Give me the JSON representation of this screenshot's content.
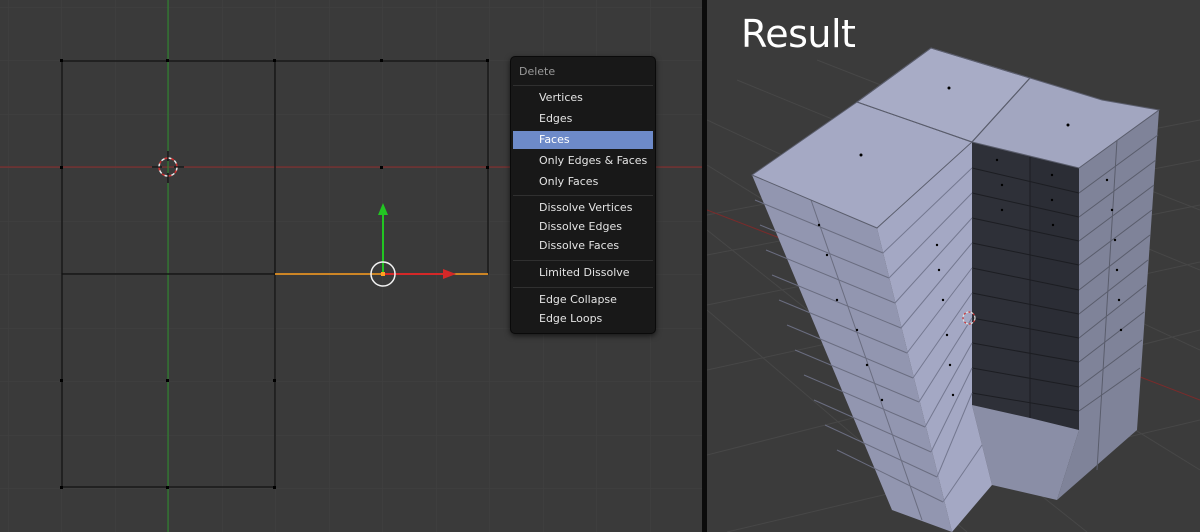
{
  "menu": {
    "title": "Delete",
    "items": [
      {
        "label": "Vertices",
        "active": false
      },
      {
        "label": "Edges",
        "active": false
      },
      {
        "label": "Faces",
        "active": true
      },
      {
        "label": "Only Edges & Faces",
        "active": false
      },
      {
        "label": "Only Faces",
        "active": false
      },
      {
        "label": "Dissolve Vertices",
        "active": false
      },
      {
        "label": "Dissolve Edges",
        "active": false
      },
      {
        "label": "Dissolve Faces",
        "active": false
      },
      {
        "label": "Limited Dissolve",
        "active": false
      },
      {
        "label": "Edge Collapse",
        "active": false
      },
      {
        "label": "Edge Loops",
        "active": false
      }
    ]
  },
  "result": {
    "title": "Result"
  },
  "colors": {
    "viewport_bg": "#3a3a3a",
    "x_axis": "#8e2b2b",
    "y_axis": "#2b8e2b",
    "selected_edge": "#ffa020",
    "menu_highlight": "#6d8ac9",
    "mesh_face": "#8f93ad"
  }
}
